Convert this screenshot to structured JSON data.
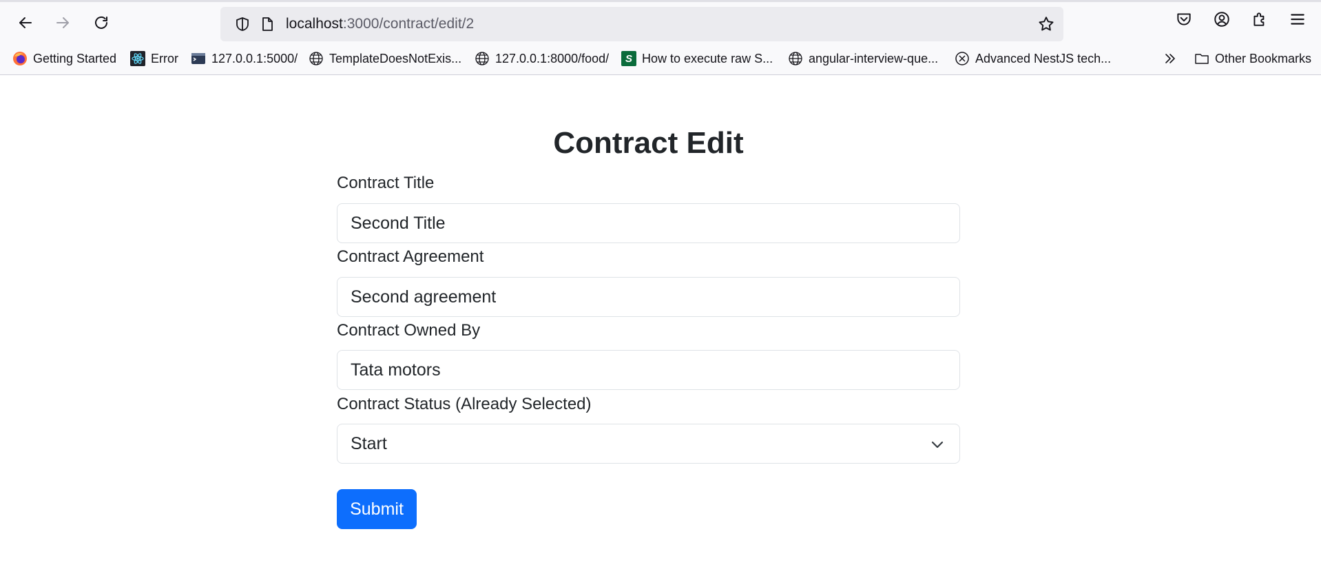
{
  "browser": {
    "url_host": "localhost",
    "url_path": ":3000/contract/edit/2",
    "bookmarks": [
      {
        "label": "Getting Started",
        "icon": "firefox-icon"
      },
      {
        "label": "Error",
        "icon": "react-icon"
      },
      {
        "label": "127.0.0.1:5000/",
        "icon": "terminal-icon"
      },
      {
        "label": "TemplateDoesNotExis...",
        "icon": "globe-icon"
      },
      {
        "label": "127.0.0.1:8000/food/",
        "icon": "globe-icon"
      },
      {
        "label": "How to execute raw S...",
        "icon": "s-icon"
      },
      {
        "label": "angular-interview-que...",
        "icon": "globe-icon"
      },
      {
        "label": "Advanced NestJS tech...",
        "icon": "x-circle-icon"
      }
    ],
    "other_bookmarks": "Other Bookmarks",
    "s_icon_letter": "S"
  },
  "page": {
    "title": "Contract Edit",
    "fields": [
      {
        "label": "Contract Title",
        "value": "Second Title"
      },
      {
        "label": "Contract Agreement",
        "value": "Second agreement"
      },
      {
        "label": "Contract Owned By",
        "value": "Tata motors"
      }
    ],
    "status": {
      "label": "Contract Status (Already Selected)",
      "value": "Start"
    },
    "submit_label": "Submit"
  },
  "colors": {
    "primary": "#0d6efd",
    "text": "#212529",
    "border": "#dee2e6"
  }
}
